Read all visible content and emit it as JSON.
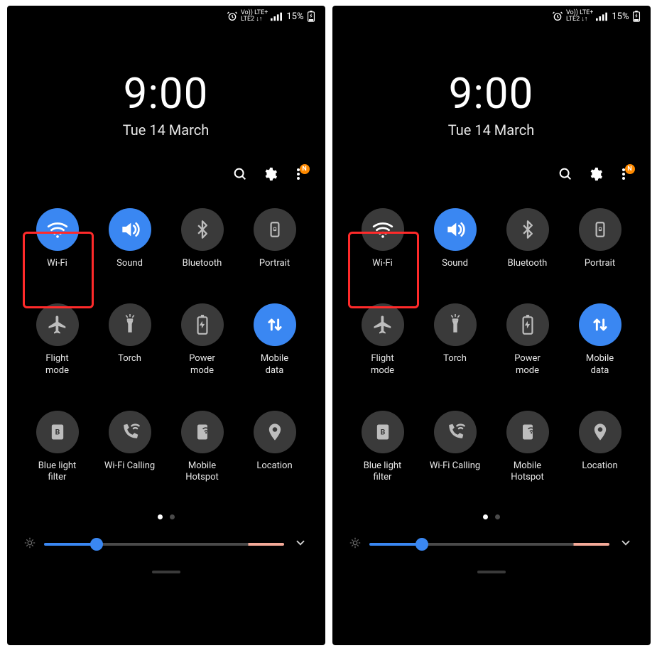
{
  "status": {
    "net_line1": "Vo)) LTE+",
    "net_line2": "LTE2 ↓↑",
    "battery_text": "15%"
  },
  "clock": {
    "time": "9:00",
    "date": "Tue 14 March"
  },
  "menu_badge": "N",
  "tiles": [
    {
      "key": "wifi",
      "label": "Wi-Fi"
    },
    {
      "key": "sound",
      "label": "Sound"
    },
    {
      "key": "bluetooth",
      "label": "Bluetooth"
    },
    {
      "key": "portrait",
      "label": "Portrait"
    },
    {
      "key": "flight",
      "label": "Flight\nmode"
    },
    {
      "key": "torch",
      "label": "Torch"
    },
    {
      "key": "power",
      "label": "Power\nmode"
    },
    {
      "key": "mobiledata",
      "label": "Mobile\ndata"
    },
    {
      "key": "bluelight",
      "label": "Blue light\nfilter"
    },
    {
      "key": "wificall",
      "label": "Wi-Fi Calling"
    },
    {
      "key": "hotspot",
      "label": "Mobile\nHotspot"
    },
    {
      "key": "location",
      "label": "Location"
    }
  ],
  "panels": [
    {
      "active_tiles": [
        "wifi",
        "sound",
        "mobiledata"
      ],
      "highlight": "wifi"
    },
    {
      "active_tiles": [
        "sound",
        "mobiledata"
      ],
      "highlight": "wifi"
    }
  ],
  "colors": {
    "accent": "#3a87f2",
    "tile_off": "#3a3a3a",
    "highlight": "#ff2a2a",
    "badge": "#ff8a00"
  },
  "brightness_percent": 22
}
